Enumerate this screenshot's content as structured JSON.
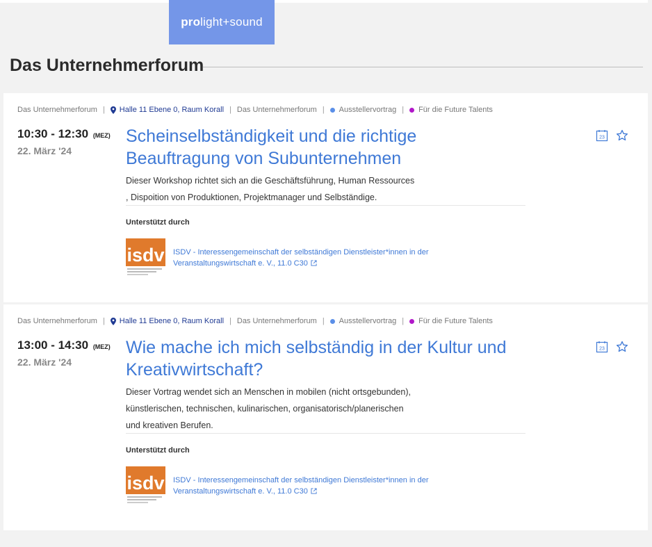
{
  "brand": {
    "bold": "pro",
    "rest": "light+sound"
  },
  "section": {
    "title": "Das Unternehmerforum"
  },
  "colors": {
    "accent": "#3f79d6",
    "brand_badge": "#7496e8",
    "category_dot": "#5b8fe8",
    "talent_dot": "#b118c9"
  },
  "events": [
    {
      "meta": {
        "forum": "Das Unternehmerforum",
        "location": "Halle 11 Ebene 0, Raum Korall",
        "forum2": "Das Unternehmerforum",
        "category": "Ausstellervortrag",
        "audience": "Für die Future Talents"
      },
      "time": "10:30 - 12:30",
      "timezone": "(MEZ)",
      "date": "22. März '24",
      "title": "Scheinselbständigkeit und die richtige Beauftragung von Subunternehmen",
      "description_lines": [
        "Dieser Workshop richtet sich an die Geschäftsführung, Human Ressources",
        ", Dispoition von Produktionen, Projektmanager und Selbständige."
      ],
      "supported_label": "Unterstützt durch",
      "sponsor_logo_text": "isdv",
      "sponsor_lines": [
        "ISDV - Interessengemeinschaft der selbständigen Dienstleister*innen in der",
        "Veranstaltungswirtschaft e. V., 11.0 C30"
      ],
      "calendar_icon_text": "23"
    },
    {
      "meta": {
        "forum": "Das Unternehmerforum",
        "location": "Halle 11 Ebene 0, Raum Korall",
        "forum2": "Das Unternehmerforum",
        "category": "Ausstellervortrag",
        "audience": "Für die Future Talents"
      },
      "time": "13:00 - 14:30",
      "timezone": "(MEZ)",
      "date": "22. März '24",
      "title": "Wie mache ich mich selbständig in der Kultur und Kreativwirtschaft?",
      "description_lines": [
        "Dieser Vortrag wendet sich an Menschen in mobilen (nicht ortsgebunden),",
        "künstlerischen, technischen, kulinarischen, organisatorisch/planerischen",
        "und kreativen Berufen."
      ],
      "supported_label": "Unterstützt durch",
      "sponsor_logo_text": "isdv",
      "sponsor_lines": [
        "ISDV - Interessengemeinschaft der selbständigen Dienstleister*innen in der",
        "Veranstaltungswirtschaft e. V., 11.0 C30"
      ],
      "calendar_icon_text": "23"
    }
  ]
}
